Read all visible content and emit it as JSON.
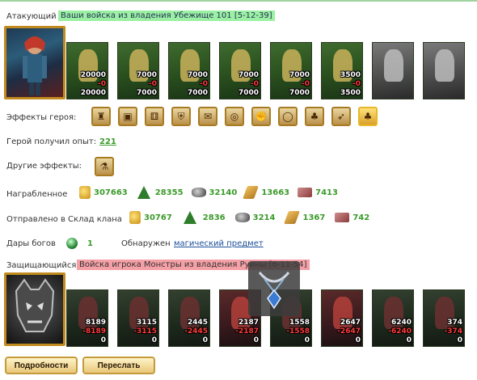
{
  "attacker": {
    "label": "Атакующий",
    "title": "Ваши войска из владения Убежище 101 [5-12-39]",
    "units": [
      {
        "icon": "archer-unit-icon",
        "theme": "green",
        "count": "20000",
        "lost": "-0",
        "remain": "20000"
      },
      {
        "icon": "swordsman-unit-icon",
        "theme": "green",
        "count": "7000",
        "lost": "-0",
        "remain": "7000"
      },
      {
        "icon": "paladin-unit-icon",
        "theme": "green",
        "count": "7000",
        "lost": "-0",
        "remain": "7000"
      },
      {
        "icon": "griffin-unit-icon",
        "theme": "green",
        "count": "7000",
        "lost": "-0",
        "remain": "7000"
      },
      {
        "icon": "crossbowman-unit-icon",
        "theme": "green",
        "count": "7000",
        "lost": "-0",
        "remain": "7000"
      },
      {
        "icon": "angel-unit-icon",
        "theme": "green",
        "count": "3500",
        "lost": "-0",
        "remain": "3500"
      },
      {
        "icon": "hooded-unit-icon",
        "theme": "gray",
        "count": "",
        "lost": "",
        "remain": ""
      },
      {
        "icon": "ghost-unit-icon",
        "theme": "gray",
        "count": "",
        "lost": "",
        "remain": ""
      }
    ]
  },
  "hero_effects": {
    "label": "Эффекты героя:",
    "icons": [
      "pouch-icon",
      "chest-icon",
      "dice-icon",
      "shield-icon",
      "scroll-icon",
      "rune-icon",
      "fist-icon",
      "ring-icon",
      "clover-icon",
      "bow-icon",
      "clover-gold-icon"
    ]
  },
  "experience": {
    "label": "Герой получил опыт:",
    "value": "221"
  },
  "other_effects": {
    "label": "Другие эффекты:",
    "icon": "potion-icon"
  },
  "loot": {
    "label": "Награбленное",
    "values": {
      "gold": "307663",
      "wood": "28355",
      "ore": "32140",
      "sulfur": "13663",
      "gems": "7413"
    }
  },
  "clan": {
    "label": "Отправлено в Склад клана",
    "values": {
      "gold": "30767",
      "wood": "2836",
      "ore": "3214",
      "sulfur": "1367",
      "gems": "742"
    }
  },
  "gods": {
    "label": "Дары богов",
    "value": "1",
    "found_label": "Обнаружен",
    "found_item": "магический предмет"
  },
  "defender": {
    "label": "Защищающийся",
    "title": "Войска игрока Монстры из владения Руины [6-11-54]",
    "units": [
      {
        "icon": "dragon-unit-icon",
        "theme": "dark",
        "count": "8189",
        "lost": "-8189",
        "remain": "0"
      },
      {
        "icon": "golem-unit-icon",
        "theme": "dark",
        "count": "3115",
        "lost": "-3115",
        "remain": "0"
      },
      {
        "icon": "orc-unit-icon",
        "theme": "dark",
        "count": "2445",
        "lost": "-2445",
        "remain": "0"
      },
      {
        "icon": "demon-unit-icon",
        "theme": "red",
        "count": "2187",
        "lost": "-2187",
        "remain": "0"
      },
      {
        "icon": "wraith-unit-icon",
        "theme": "dark",
        "count": "1558",
        "lost": "-1558",
        "remain": "0"
      },
      {
        "icon": "beast-unit-icon",
        "theme": "red",
        "count": "2647",
        "lost": "-2647",
        "remain": "0"
      },
      {
        "icon": "tower-unit-icon",
        "theme": "dark",
        "count": "6240",
        "lost": "-6240",
        "remain": "0"
      },
      {
        "icon": "sorcerer-unit-icon",
        "theme": "dark",
        "count": "374",
        "lost": "-374",
        "remain": "0"
      }
    ]
  },
  "tooltip": {
    "icon": "amulet-icon"
  },
  "buttons": {
    "details": "Подробности",
    "forward": "Переслать"
  }
}
